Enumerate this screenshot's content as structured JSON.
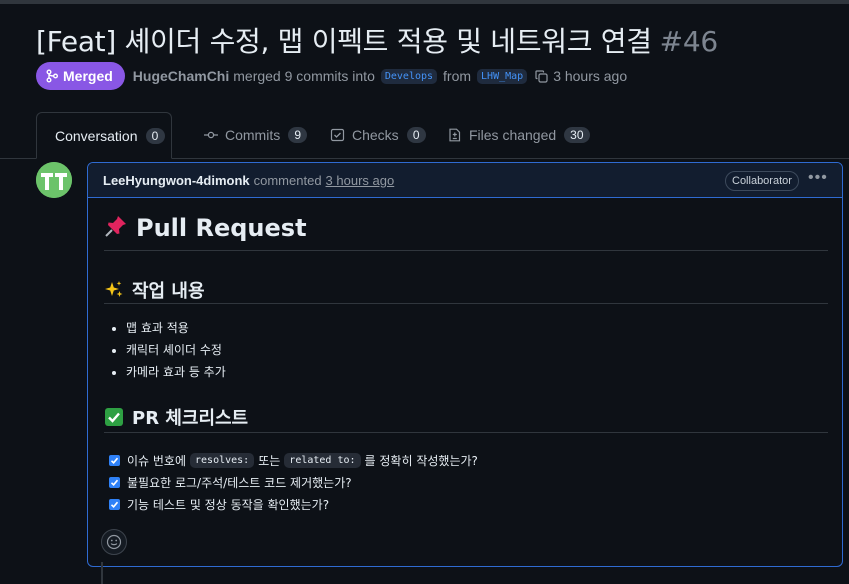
{
  "pr": {
    "title": "[Feat] 셰이더 수정, 맵 이펙트 적용 및 네트워크 연결",
    "number": "#46",
    "status": "Merged",
    "author": "HugeChamChi",
    "merge_text": "merged 9 commits into",
    "base_branch": "Develops",
    "from_text": "from",
    "head_branch": "LHW_Map",
    "time": "3 hours ago"
  },
  "tabs": [
    {
      "label": "Conversation",
      "count": "0",
      "icon": "conversation-icon"
    },
    {
      "label": "Commits",
      "count": "9",
      "icon": "commit-icon"
    },
    {
      "label": "Checks",
      "count": "0",
      "icon": "checks-icon"
    },
    {
      "label": "Files changed",
      "count": "30",
      "icon": "file-diff-icon"
    }
  ],
  "comment": {
    "author": "LeeHyungwon-4dimonk",
    "action": "commented",
    "time": "3 hours ago",
    "role": "Collaborator",
    "h1": "Pull Request",
    "section1": {
      "heading": "작업 내용",
      "items": [
        "맵 효과 적용",
        "캐릭터 셰이더 수정",
        "카메라 효과 등 추가"
      ]
    },
    "section2": {
      "heading": "PR 체크리스트",
      "check1": {
        "before": "이슈 번호에",
        "code1": "resolves:",
        "mid": "또는",
        "code2": "related to:",
        "after": "를 정확히 작성했는가?"
      },
      "check2": "불필요한 로그/주석/테스트 코드 제거했는가?",
      "check3": "기능 테스트 및 정상 동작을 확인했는가?"
    }
  },
  "colors": {
    "background": "#0d1117",
    "merged": "#8957e5",
    "accent_border": "#2f6bd2",
    "link": "#4493f8"
  }
}
